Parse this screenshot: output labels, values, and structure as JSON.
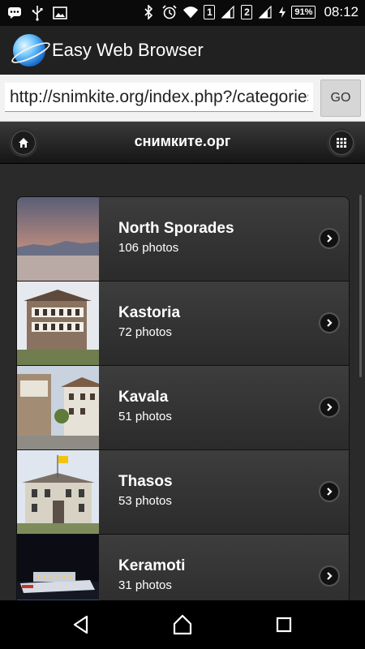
{
  "status_bar": {
    "sim1": "1",
    "sim2": "2",
    "battery": "91%",
    "time": "08:12",
    "left_icons": [
      "chat-icon",
      "usb-icon",
      "image-icon"
    ],
    "right_icons": [
      "bluetooth-icon",
      "alarm-icon",
      "wifi-icon",
      "signal-icon",
      "signal-icon",
      "charging-icon"
    ]
  },
  "app": {
    "title": "Easy Web Browser",
    "logo_icon": "globe-icon"
  },
  "urlbar": {
    "value": "http://snimkite.org/index.php?/categories",
    "go_label": "GO"
  },
  "site": {
    "title": "снимките.орг",
    "home_icon": "home-icon",
    "menu_icon": "grid-icon"
  },
  "categories": [
    {
      "title": "North Sporades",
      "count": "106 photos"
    },
    {
      "title": "Kastoria",
      "count": "72 photos"
    },
    {
      "title": "Kavala",
      "count": "51 photos"
    },
    {
      "title": "Thasos",
      "count": "53 photos"
    },
    {
      "title": "Keramoti",
      "count": "31 photos"
    }
  ],
  "navbar": {
    "icons": [
      "back-icon",
      "home-icon",
      "recents-icon"
    ]
  },
  "colors": {
    "page_bg": "#2a2a2a",
    "appbar_bg": "#212121",
    "accent": "#1a6fd1"
  }
}
